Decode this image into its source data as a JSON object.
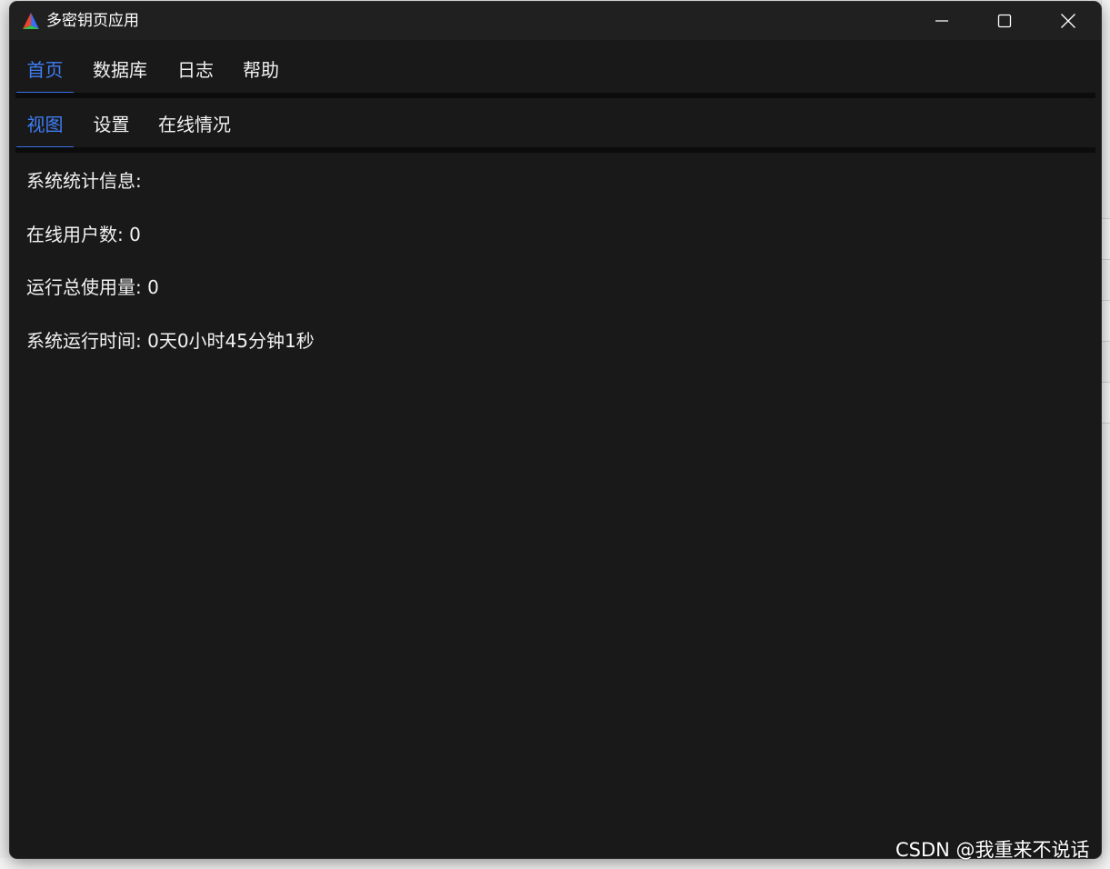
{
  "window": {
    "title": "多密钥页应用",
    "controls": [
      "minimize-icon",
      "maximize-icon",
      "close-icon"
    ]
  },
  "main_tabs": [
    {
      "label": "首页",
      "active": true
    },
    {
      "label": "数据库",
      "active": false
    },
    {
      "label": "日志",
      "active": false
    },
    {
      "label": "帮助",
      "active": false
    }
  ],
  "sub_tabs": [
    {
      "label": "视图",
      "active": true
    },
    {
      "label": "设置",
      "active": false
    },
    {
      "label": "在线情况",
      "active": false
    }
  ],
  "stats": {
    "heading": "系统统计信息:",
    "online_users": "在线用户数: 0",
    "total_usage": "运行总使用量: 0",
    "uptime": "系统运行时间: 0天0小时45分钟1秒"
  },
  "watermark": "CSDN @我重来不说话",
  "colors": {
    "accent": "#3a72ea",
    "background": "#191919",
    "titlebar": "#202020",
    "text": "#f2f2f2"
  }
}
